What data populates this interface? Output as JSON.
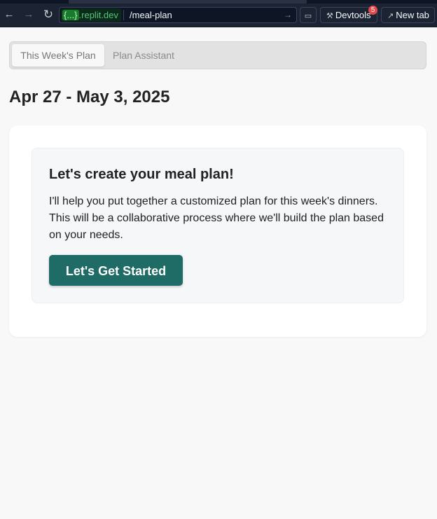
{
  "browser": {
    "url_host_braces": "{...}",
    "url_host": ".replit.dev",
    "url_path": "/meal-plan",
    "devtools_label": "Devtools",
    "devtools_badge": "5",
    "new_tab_label": "New tab"
  },
  "tabs": [
    {
      "label": "This Week's Plan",
      "active": true
    },
    {
      "label": "Plan Assistant",
      "active": false
    }
  ],
  "date_range": "Apr 27 - May 3, 2025",
  "intro": {
    "title": "Let's create your meal plan!",
    "body": "I'll help you put together a customized plan for this week's dinners. This will be a collaborative process where we'll build the plan based on your needs.",
    "button_label": "Let's Get Started"
  },
  "colors": {
    "accent": "#1f6b66",
    "chrome_bg": "#1c2333",
    "page_bg": "#f8f8f8"
  }
}
